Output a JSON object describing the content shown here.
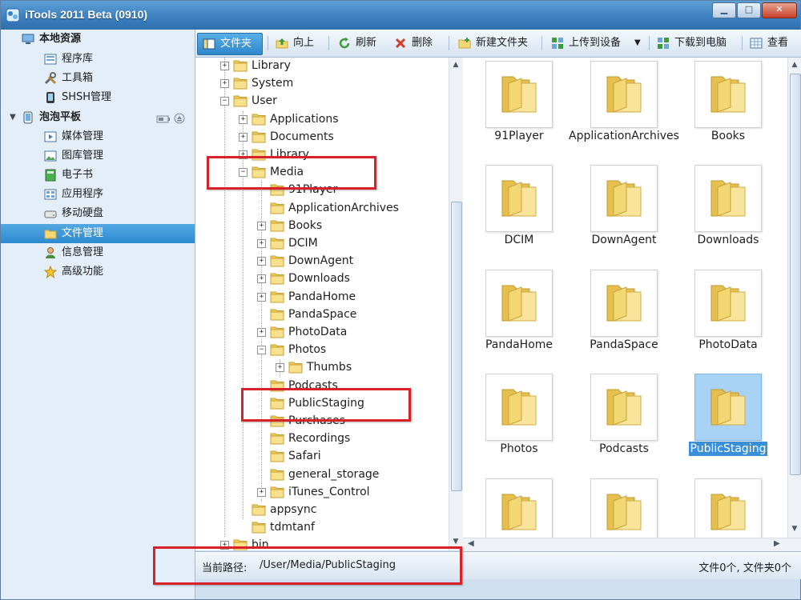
{
  "window": {
    "title": "iTools 2011 Beta (0910)"
  },
  "window_controls": {
    "minimize": "▁",
    "maximize": "□",
    "close": "✕"
  },
  "sidebar": {
    "local_group": "本地资源",
    "local_items": [
      "程序库",
      "工具箱",
      "SHSH管理"
    ],
    "device_group": "泡泡平板",
    "device_items": [
      "媒体管理",
      "图库管理",
      "电子书",
      "应用程序",
      "移动硬盘",
      "文件管理",
      "信息管理",
      "高级功能"
    ],
    "selected": "文件管理"
  },
  "toolbar": {
    "folder": "文件夹",
    "up": "向上",
    "refresh": "刷新",
    "delete": "删除",
    "new_folder": "新建文件夹",
    "upload": "上传到设备",
    "download": "下载到电脑",
    "view": "查看"
  },
  "tree": {
    "rows": [
      {
        "label": "Library",
        "exp": "+"
      },
      {
        "label": "System",
        "exp": "+"
      },
      {
        "label": "User",
        "exp": "−"
      },
      {
        "label": "Applications",
        "exp": "+"
      },
      {
        "label": "Documents",
        "exp": "+"
      },
      {
        "label": "Library",
        "exp": "+"
      },
      {
        "label": "Media",
        "exp": "−"
      },
      {
        "label": "91Player",
        "exp": ""
      },
      {
        "label": "ApplicationArchives",
        "exp": ""
      },
      {
        "label": "Books",
        "exp": "+"
      },
      {
        "label": "DCIM",
        "exp": "+"
      },
      {
        "label": "DownAgent",
        "exp": "+"
      },
      {
        "label": "Downloads",
        "exp": "+"
      },
      {
        "label": "PandaHome",
        "exp": "+"
      },
      {
        "label": "PandaSpace",
        "exp": ""
      },
      {
        "label": "PhotoData",
        "exp": "+"
      },
      {
        "label": "Photos",
        "exp": "−"
      },
      {
        "label": "Thumbs",
        "exp": "+"
      },
      {
        "label": "Podcasts",
        "exp": ""
      },
      {
        "label": "PublicStaging",
        "exp": ""
      },
      {
        "label": "Purchases",
        "exp": ""
      },
      {
        "label": "Recordings",
        "exp": ""
      },
      {
        "label": "Safari",
        "exp": ""
      },
      {
        "label": "general_storage",
        "exp": ""
      },
      {
        "label": "iTunes_Control",
        "exp": "+"
      },
      {
        "label": "appsync",
        "exp": ""
      },
      {
        "label": "tdmtanf",
        "exp": ""
      },
      {
        "label": "bin",
        "exp": "+"
      }
    ]
  },
  "grid": {
    "items": [
      "91Player",
      "ApplicationArchives",
      "Books",
      "DCIM",
      "DownAgent",
      "Downloads",
      "PandaHome",
      "PandaSpace",
      "PhotoData",
      "Photos",
      "Podcasts",
      "PublicStaging",
      "",
      "",
      ""
    ],
    "selected": "PublicStaging"
  },
  "statusbar": {
    "path_label": "当前路径:",
    "path_value": "/User/Media/PublicStaging",
    "count": "文件0个, 文件夹0个"
  },
  "colors": {
    "accent": "#2d8ad0",
    "annotation": "#d9212a",
    "folder": "#f3d773"
  }
}
